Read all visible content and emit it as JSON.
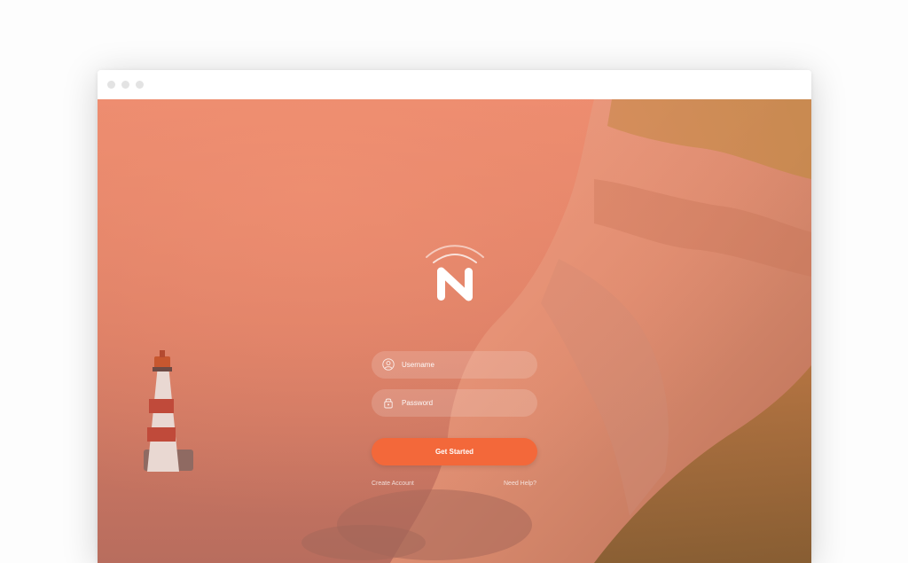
{
  "window": {
    "controls": [
      "close-dot",
      "minimize-dot",
      "maximize-dot"
    ]
  },
  "brand": {
    "logo_icon": "n-signal-logo-icon"
  },
  "login": {
    "username": {
      "placeholder": "Username",
      "value": "",
      "icon": "user-icon"
    },
    "password": {
      "placeholder": "Password",
      "value": "",
      "icon": "lock-icon"
    },
    "submit_label": "Get Started",
    "create_account_label": "Create Account",
    "help_label": "Need Help?"
  },
  "colors": {
    "accent": "#f3683a",
    "overlay": "#ec8a6c"
  }
}
